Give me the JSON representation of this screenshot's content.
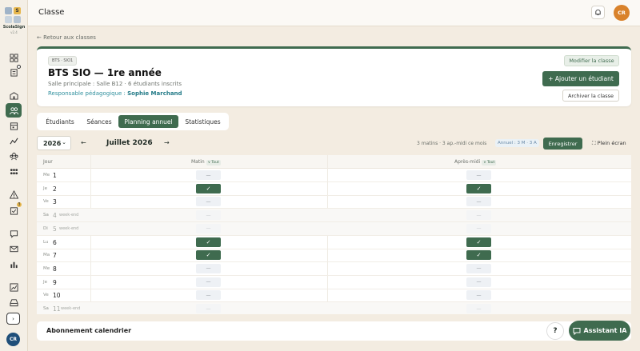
{
  "app": {
    "name": "ScolaSign",
    "version": "v2.4"
  },
  "header": {
    "title": "Classe",
    "avatar": "CR"
  },
  "sidebar": {
    "badge_bulletin": "3",
    "avatar": "CR"
  },
  "back_link": "← Retour aux classes",
  "class": {
    "tag": "BTS · SIO1",
    "title": "BTS SIO — 1re année",
    "subtitle": "Salle principale : Salle B12 · 6 étudiants inscrits",
    "responsable_label": "Responsable pédagogique :",
    "responsable_name": "Sophie Marchand",
    "btn_modify": "Modifier la classe",
    "btn_add": "+ Ajouter un étudiant",
    "btn_archive": "Archiver la classe"
  },
  "tabs": [
    "Étudiants",
    "Séances",
    "Planning annuel",
    "Statistiques"
  ],
  "active_tab": "Planning annuel",
  "planning": {
    "year": "2026",
    "month": "Juillet 2026",
    "summary": "3 matins · 3 ap.-midi ce mois",
    "annuel": "Annuel : 3 M · 3 A",
    "save": "Enregistrer",
    "fullscreen": "⛶ Plein écran",
    "col_day": "Jour",
    "col_morning": "Matin",
    "col_afternoon": "Après-midi",
    "pill_all": "∨ Tout",
    "weekend_label": "week-end",
    "rows": [
      {
        "dow": "Me",
        "day": "1",
        "weekend": false,
        "morning": "—",
        "afternoon": "—",
        "m_on": false,
        "a_on": false
      },
      {
        "dow": "Je",
        "day": "2",
        "weekend": false,
        "morning": "✓",
        "afternoon": "✓",
        "m_on": true,
        "a_on": true
      },
      {
        "dow": "Ve",
        "day": "3",
        "weekend": false,
        "morning": "—",
        "afternoon": "—",
        "m_on": false,
        "a_on": false
      },
      {
        "dow": "Sa",
        "day": "4",
        "weekend": true,
        "morning": "—",
        "afternoon": "—",
        "m_on": false,
        "a_on": false
      },
      {
        "dow": "Di",
        "day": "5",
        "weekend": true,
        "morning": "—",
        "afternoon": "—",
        "m_on": false,
        "a_on": false
      },
      {
        "dow": "Lu",
        "day": "6",
        "weekend": false,
        "morning": "✓",
        "afternoon": "✓",
        "m_on": true,
        "a_on": true
      },
      {
        "dow": "Ma",
        "day": "7",
        "weekend": false,
        "morning": "✓",
        "afternoon": "✓",
        "m_on": true,
        "a_on": true
      },
      {
        "dow": "Me",
        "day": "8",
        "weekend": false,
        "morning": "—",
        "afternoon": "—",
        "m_on": false,
        "a_on": false
      },
      {
        "dow": "Je",
        "day": "9",
        "weekend": false,
        "morning": "—",
        "afternoon": "—",
        "m_on": false,
        "a_on": false
      },
      {
        "dow": "Ve",
        "day": "10",
        "weekend": false,
        "morning": "—",
        "afternoon": "—",
        "m_on": false,
        "a_on": false
      },
      {
        "dow": "Sa",
        "day": "11",
        "weekend": true,
        "morning": "—",
        "afternoon": "—",
        "m_on": false,
        "a_on": false
      }
    ]
  },
  "subscription": "Abonnement calendrier",
  "help": "?",
  "assistant": "Assistant IA",
  "colors": {
    "primary": "#3f6b4f",
    "accent": "#d9822b",
    "background": "#f3ece1"
  }
}
